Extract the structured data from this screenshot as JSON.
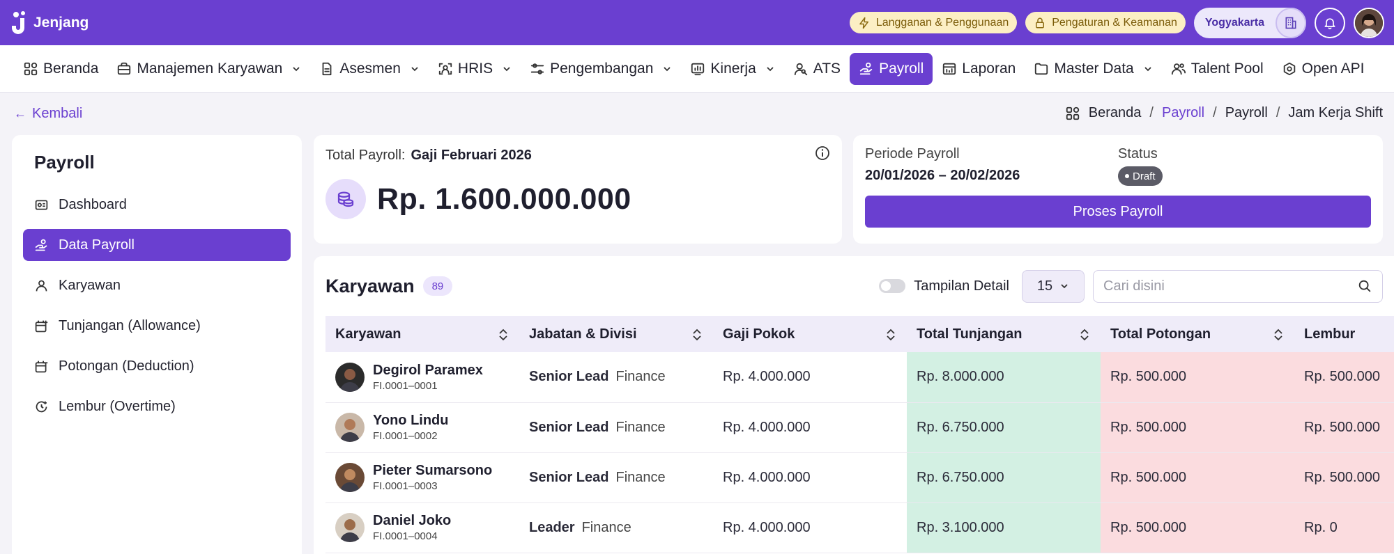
{
  "app": {
    "name": "Jenjang"
  },
  "topbar": {
    "subscription_label": "Langganan & Penggunaan",
    "settings_label": "Pengaturan & Keamanan",
    "city": "Yogyakarta"
  },
  "nav": [
    {
      "label": "Beranda",
      "icon": "home-grid-icon",
      "dropdown": false,
      "active": false
    },
    {
      "label": "Manajemen Karyawan",
      "icon": "briefcase-icon",
      "dropdown": true,
      "active": false
    },
    {
      "label": "Asesmen",
      "icon": "document-icon",
      "dropdown": true,
      "active": false
    },
    {
      "label": "HRIS",
      "icon": "scan-user-icon",
      "dropdown": true,
      "active": false
    },
    {
      "label": "Pengembangan",
      "icon": "sliders-icon",
      "dropdown": true,
      "active": false
    },
    {
      "label": "Kinerja",
      "icon": "chart-board-icon",
      "dropdown": true,
      "active": false
    },
    {
      "label": "ATS",
      "icon": "user-search-icon",
      "dropdown": false,
      "active": false
    },
    {
      "label": "Payroll",
      "icon": "hand-money-icon",
      "dropdown": false,
      "active": true
    },
    {
      "label": "Laporan",
      "icon": "report-icon",
      "dropdown": false,
      "active": false
    },
    {
      "label": "Master Data",
      "icon": "folder-icon",
      "dropdown": true,
      "active": false
    },
    {
      "label": "Talent Pool",
      "icon": "users-icon",
      "dropdown": false,
      "active": false
    },
    {
      "label": "Open API",
      "icon": "api-icon",
      "dropdown": false,
      "active": false
    }
  ],
  "back_label": "Kembali",
  "breadcrumb": {
    "home": "Beranda",
    "level1": "Payroll",
    "level2": "Payroll",
    "current": "Jam Kerja Shift"
  },
  "sidebar": {
    "title": "Payroll",
    "items": [
      {
        "label": "Dashboard",
        "active": false
      },
      {
        "label": "Data Payroll",
        "active": true
      },
      {
        "label": "Karyawan",
        "active": false
      },
      {
        "label": "Tunjangan (Allowance)",
        "active": false
      },
      {
        "label": "Potongan (Deduction)",
        "active": false
      },
      {
        "label": "Lembur (Overtime)",
        "active": false
      }
    ]
  },
  "total": {
    "label": "Total Payroll:",
    "name": "Gaji Februari 2026",
    "amount": "Rp. 1.600.000.000"
  },
  "period": {
    "label": "Periode Payroll",
    "value": "20/01/2026 – 20/02/2026",
    "status_label": "Status",
    "status": "Draft",
    "process_label": "Proses Payroll"
  },
  "employees": {
    "title": "Karyawan",
    "count": "89",
    "detail_toggle_label": "Tampilan Detail",
    "detail_toggle_on": false,
    "page_size": "15",
    "search_placeholder": "Cari disini",
    "columns": [
      "Karyawan",
      "Jabatan & Divisi",
      "Gaji Pokok",
      "Total Tunjangan",
      "Total Potongan",
      "Lembur"
    ],
    "rows": [
      {
        "name": "Degirol Paramex",
        "id": "FI.0001–0001",
        "position": "Senior Lead",
        "division": "Finance",
        "salary": "Rp. 4.000.000",
        "allowance": "Rp. 8.000.000",
        "deduction": "Rp. 500.000",
        "overtime": "Rp. 500.000"
      },
      {
        "name": "Yono Lindu",
        "id": "FI.0001–0002",
        "position": "Senior Lead",
        "division": "Finance",
        "salary": "Rp. 4.000.000",
        "allowance": "Rp. 6.750.000",
        "deduction": "Rp. 500.000",
        "overtime": "Rp. 500.000"
      },
      {
        "name": "Pieter Sumarsono",
        "id": "FI.0001–0003",
        "position": "Senior Lead",
        "division": "Finance",
        "salary": "Rp. 4.000.000",
        "allowance": "Rp. 6.750.000",
        "deduction": "Rp. 500.000",
        "overtime": "Rp. 500.000"
      },
      {
        "name": "Daniel Joko",
        "id": "FI.0001–0004",
        "position": "Leader",
        "division": "Finance",
        "salary": "Rp. 4.000.000",
        "allowance": "Rp. 3.100.000",
        "deduction": "Rp. 500.000",
        "overtime": "Rp. 0"
      }
    ]
  },
  "colors": {
    "primary": "#6a3fd0",
    "allowance_bg": "#d3f0e3",
    "deduction_bg": "#fbdcdf",
    "draft_bg": "#5b5b66"
  }
}
